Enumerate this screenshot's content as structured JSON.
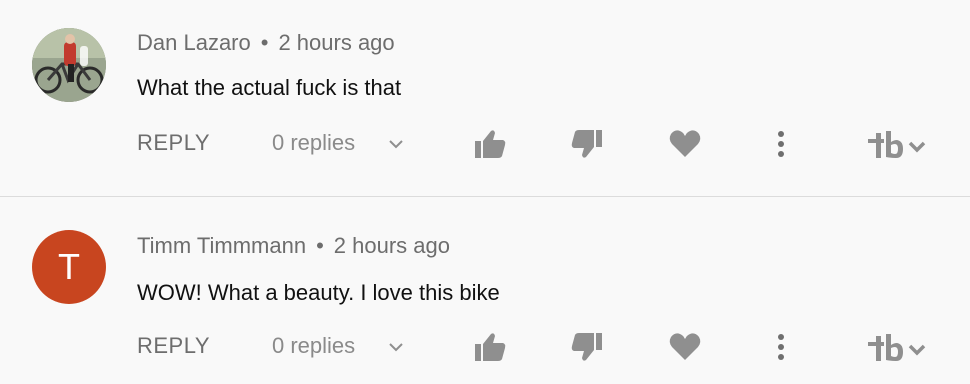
{
  "comments": [
    {
      "author": "Dan Lazaro",
      "separator": "•",
      "time": "2 hours ago",
      "text": "What the actual fuck is that",
      "avatar_type": "photo",
      "reply_label": "REPLY",
      "replies_label": "0 replies"
    },
    {
      "author": "Timm Timmmann",
      "separator": "•",
      "time": "2 hours ago",
      "text": "WOW! What a beauty. I love this bike",
      "avatar_type": "letter",
      "avatar_letter": "T",
      "avatar_color": "#c8451f",
      "reply_label": "REPLY",
      "replies_label": "0 replies"
    }
  ],
  "icons": {
    "like": "thumbs-up-icon",
    "dislike": "thumbs-down-icon",
    "heart": "heart-icon",
    "more": "more-vertical-icon",
    "brand": "tb-logo-icon",
    "expand": "chevron-down-icon"
  },
  "colors": {
    "background": "#f9f9f9",
    "icon": "#8f8f8f",
    "text": "#111111",
    "meta": "#6d6d6d"
  }
}
